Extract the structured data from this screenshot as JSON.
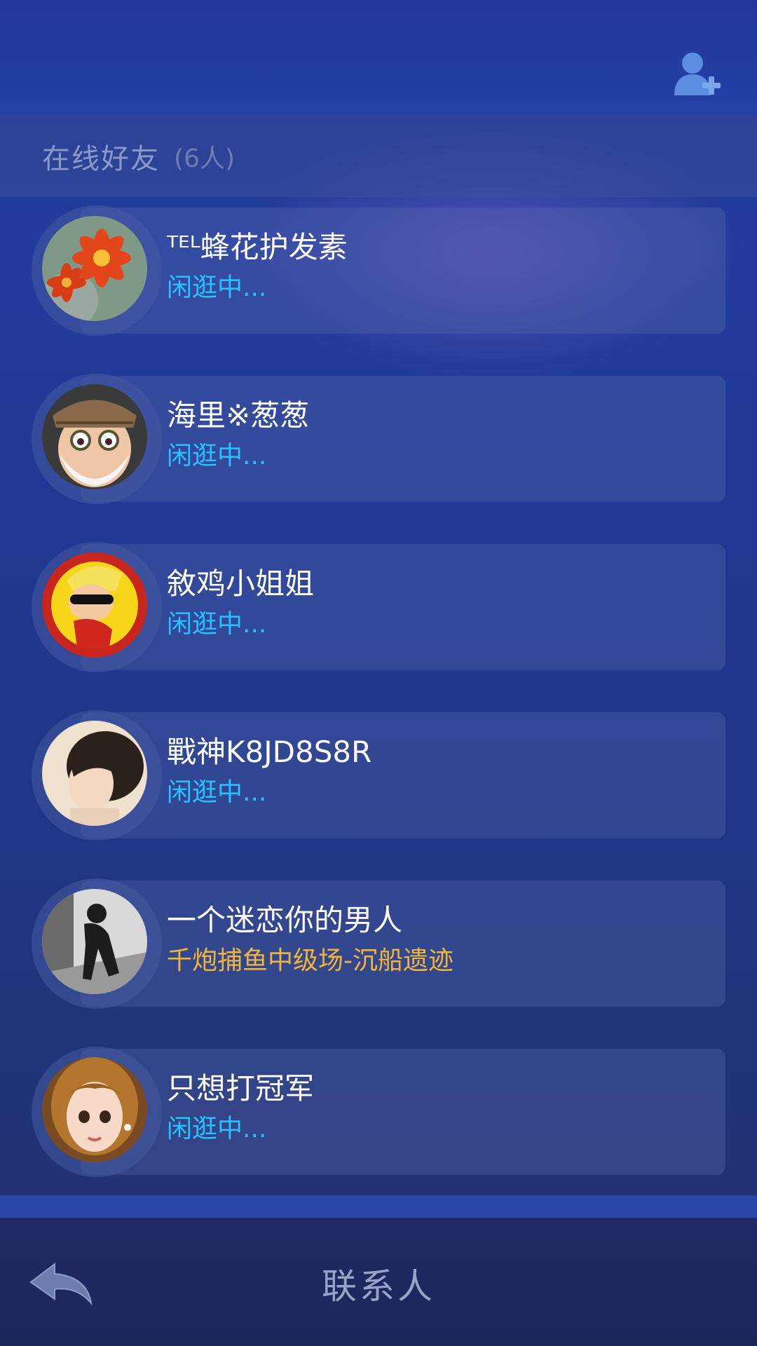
{
  "header": {
    "add_friend_icon": "add-user-icon"
  },
  "section": {
    "title": "在线好友",
    "count": "(6人)"
  },
  "friends": [
    {
      "name": "ᵀᴱᴸ蜂花护发素",
      "status": "闲逛中...",
      "status_type": "idle",
      "avatar": "red-flower-avatar"
    },
    {
      "name": "海里※葱葱",
      "status": "闲逛中...",
      "status_type": "idle",
      "avatar": "old-man-cartoon-avatar"
    },
    {
      "name": "敘鸡小姐姐",
      "status": "闲逛中...",
      "status_type": "idle",
      "avatar": "superhero-cartoon-avatar"
    },
    {
      "name": "戰神K8JD8S8R",
      "status": "闲逛中...",
      "status_type": "idle",
      "avatar": "girl-photo-avatar"
    },
    {
      "name": "一个迷恋你的男人",
      "status": "千炮捕鱼中级场-沉船遗迹",
      "status_type": "playing",
      "avatar": "silhouette-photo-avatar"
    },
    {
      "name": "只想打冠军",
      "status": "闲逛中...",
      "status_type": "idle",
      "avatar": "cartoon-girl-avatar"
    }
  ],
  "footer": {
    "title": "联系人",
    "back_icon": "back-arrow-icon"
  },
  "colors": {
    "idle_status": "#27c3ff",
    "playing_status": "#f1b43a",
    "background": "#20378f"
  }
}
